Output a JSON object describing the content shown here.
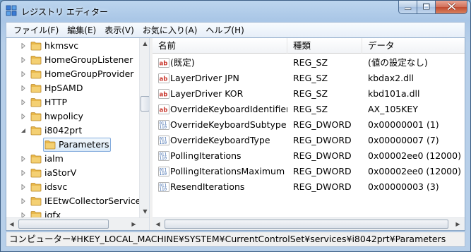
{
  "window": {
    "title": "レジストリ エディター"
  },
  "menu": [
    "ファイル(F)",
    "編集(E)",
    "表示(V)",
    "お気に入り(A)",
    "ヘルプ(H)"
  ],
  "tree": {
    "items": [
      {
        "label": "hkmsvc",
        "expanded": false,
        "has_children": true,
        "indent": 0
      },
      {
        "label": "HomeGroupListener",
        "expanded": false,
        "has_children": true,
        "indent": 0
      },
      {
        "label": "HomeGroupProvider",
        "expanded": false,
        "has_children": true,
        "indent": 0
      },
      {
        "label": "HpSAMD",
        "expanded": false,
        "has_children": true,
        "indent": 0
      },
      {
        "label": "HTTP",
        "expanded": false,
        "has_children": true,
        "indent": 0
      },
      {
        "label": "hwpolicy",
        "expanded": false,
        "has_children": true,
        "indent": 0
      },
      {
        "label": "i8042prt",
        "expanded": true,
        "has_children": true,
        "indent": 0
      },
      {
        "label": "Parameters",
        "expanded": false,
        "has_children": false,
        "indent": 1,
        "selected": true
      },
      {
        "label": "ialm",
        "expanded": false,
        "has_children": true,
        "indent": 0
      },
      {
        "label": "iaStorV",
        "expanded": false,
        "has_children": true,
        "indent": 0
      },
      {
        "label": "idsvc",
        "expanded": false,
        "has_children": true,
        "indent": 0
      },
      {
        "label": "IEEtwCollectorService",
        "expanded": false,
        "has_children": true,
        "indent": 0
      },
      {
        "label": "igfx",
        "expanded": false,
        "has_children": true,
        "indent": 0
      }
    ]
  },
  "list": {
    "columns": [
      "名前",
      "種類",
      "データ"
    ],
    "rows": [
      {
        "icon": "string-value-icon",
        "name": "(既定)",
        "type": "REG_SZ",
        "data": "(値の設定なし)"
      },
      {
        "icon": "string-value-icon",
        "name": "LayerDriver JPN",
        "type": "REG_SZ",
        "data": "kbdax2.dll"
      },
      {
        "icon": "string-value-icon",
        "name": "LayerDriver KOR",
        "type": "REG_SZ",
        "data": "kbd101a.dll"
      },
      {
        "icon": "string-value-icon",
        "name": "OverrideKeyboardIdentifier",
        "type": "REG_SZ",
        "data": "AX_105KEY"
      },
      {
        "icon": "binary-value-icon",
        "name": "OverrideKeyboardSubtype",
        "type": "REG_DWORD",
        "data": "0x00000001 (1)"
      },
      {
        "icon": "binary-value-icon",
        "name": "OverrideKeyboardType",
        "type": "REG_DWORD",
        "data": "0x00000007 (7)"
      },
      {
        "icon": "binary-value-icon",
        "name": "PollingIterations",
        "type": "REG_DWORD",
        "data": "0x00002ee0 (12000)"
      },
      {
        "icon": "binary-value-icon",
        "name": "PollingIterationsMaximum",
        "type": "REG_DWORD",
        "data": "0x00002ee0 (12000)"
      },
      {
        "icon": "binary-value-icon",
        "name": "ResendIterations",
        "type": "REG_DWORD",
        "data": "0x00000003 (3)"
      }
    ]
  },
  "status": {
    "path": "コンピューター¥HKEY_LOCAL_MACHINE¥SYSTEM¥CurrentControlSet¥services¥i8042prt¥Parameters"
  },
  "colors": {
    "folder": "#e8b84a",
    "selection_border": "#84acdd",
    "string_icon": "#c8352b",
    "binary_icon": "#2f5fa7"
  }
}
